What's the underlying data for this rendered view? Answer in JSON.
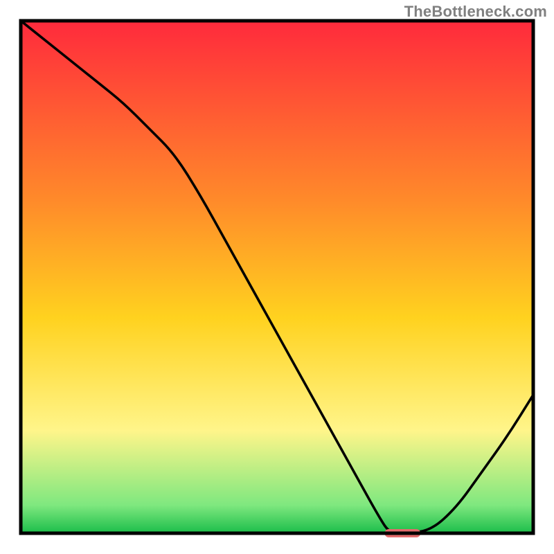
{
  "watermark": "TheBottleneck.com",
  "colors": {
    "gradient_top": "#ff2a3c",
    "gradient_mid1": "#ff8a2a",
    "gradient_mid2": "#ffd21f",
    "gradient_mid3": "#fff58a",
    "gradient_bottom_band": "#7fe87f",
    "gradient_bottom": "#1bbd4a",
    "curve_stroke": "#000000",
    "marker_fill": "#e26b6b",
    "frame_stroke": "#000000"
  },
  "chart_data": {
    "type": "line",
    "title": "",
    "xlabel": "",
    "ylabel": "",
    "xlim": [
      0,
      100
    ],
    "ylim": [
      0,
      100
    ],
    "x": [
      0,
      5,
      10,
      15,
      20,
      25,
      30,
      35,
      40,
      45,
      50,
      55,
      60,
      65,
      70,
      72,
      75,
      80,
      85,
      90,
      95,
      100
    ],
    "values": [
      100,
      96,
      92,
      88,
      84,
      79,
      74,
      66,
      57,
      48,
      39,
      30,
      21,
      12,
      3,
      0,
      0,
      0.5,
      5,
      12,
      19,
      27
    ],
    "marker": {
      "x_range": [
        71,
        78
      ],
      "y": 0
    },
    "note": "x is relative horizontal position (0=left frame edge, 100=right frame edge); values are relative bottleneck % (0=bottom/green, 100=top/red). Curve descends from top-left, bottoms out ~x=72–78, then rises toward the right."
  }
}
